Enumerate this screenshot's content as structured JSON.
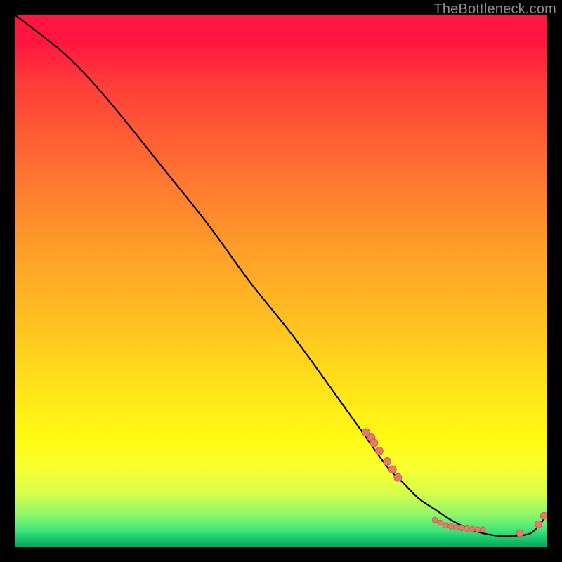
{
  "watermark": "TheBottleneck.com",
  "colors": {
    "page_bg": "#000000",
    "watermark": "#8e8e8e",
    "curve": "#000000",
    "dot_fill": "#e9776e",
    "dot_stroke": "#c9564a"
  },
  "chart_data": {
    "type": "line",
    "title": "",
    "xlabel": "",
    "ylabel": "",
    "xlim": [
      0,
      100
    ],
    "ylim": [
      0,
      100
    ],
    "legend": false,
    "grid": false,
    "background": "vertical-gradient red→green",
    "series": [
      {
        "name": "bottleneck-curve",
        "x": [
          0,
          4,
          9,
          14,
          20,
          28,
          36,
          44,
          52,
          60,
          65,
          70,
          73,
          76,
          79,
          82,
          85,
          88,
          91,
          94,
          97,
          99,
          100
        ],
        "y": [
          100,
          97,
          93,
          88,
          81,
          71,
          61,
          50,
          40,
          29,
          22,
          15,
          12,
          9,
          7,
          5,
          3.5,
          2.5,
          2,
          2,
          2.5,
          4.5,
          6
        ]
      }
    ],
    "scatter_clusters": [
      {
        "name": "descent-cluster",
        "points": [
          {
            "x": 66,
            "y": 21.5
          },
          {
            "x": 67,
            "y": 20.5
          },
          {
            "x": 67.5,
            "y": 19.5
          },
          {
            "x": 68.5,
            "y": 18
          },
          {
            "x": 70,
            "y": 16
          },
          {
            "x": 71,
            "y": 14.5
          },
          {
            "x": 72,
            "y": 13
          }
        ],
        "radius": 5.5
      },
      {
        "name": "valley-cluster",
        "points": [
          {
            "x": 79,
            "y": 5
          },
          {
            "x": 80,
            "y": 4.5
          },
          {
            "x": 81,
            "y": 4
          },
          {
            "x": 82,
            "y": 3.8
          },
          {
            "x": 83,
            "y": 3.6
          },
          {
            "x": 84,
            "y": 3.5
          },
          {
            "x": 85,
            "y": 3.4
          },
          {
            "x": 86,
            "y": 3.3
          },
          {
            "x": 87,
            "y": 3.2
          },
          {
            "x": 88,
            "y": 3.2
          }
        ],
        "radius": 4
      },
      {
        "name": "tail-cluster",
        "points": [
          {
            "x": 95,
            "y": 2.5
          },
          {
            "x": 98.5,
            "y": 4.2
          },
          {
            "x": 99.5,
            "y": 5.8
          }
        ],
        "radius": 5
      }
    ]
  }
}
